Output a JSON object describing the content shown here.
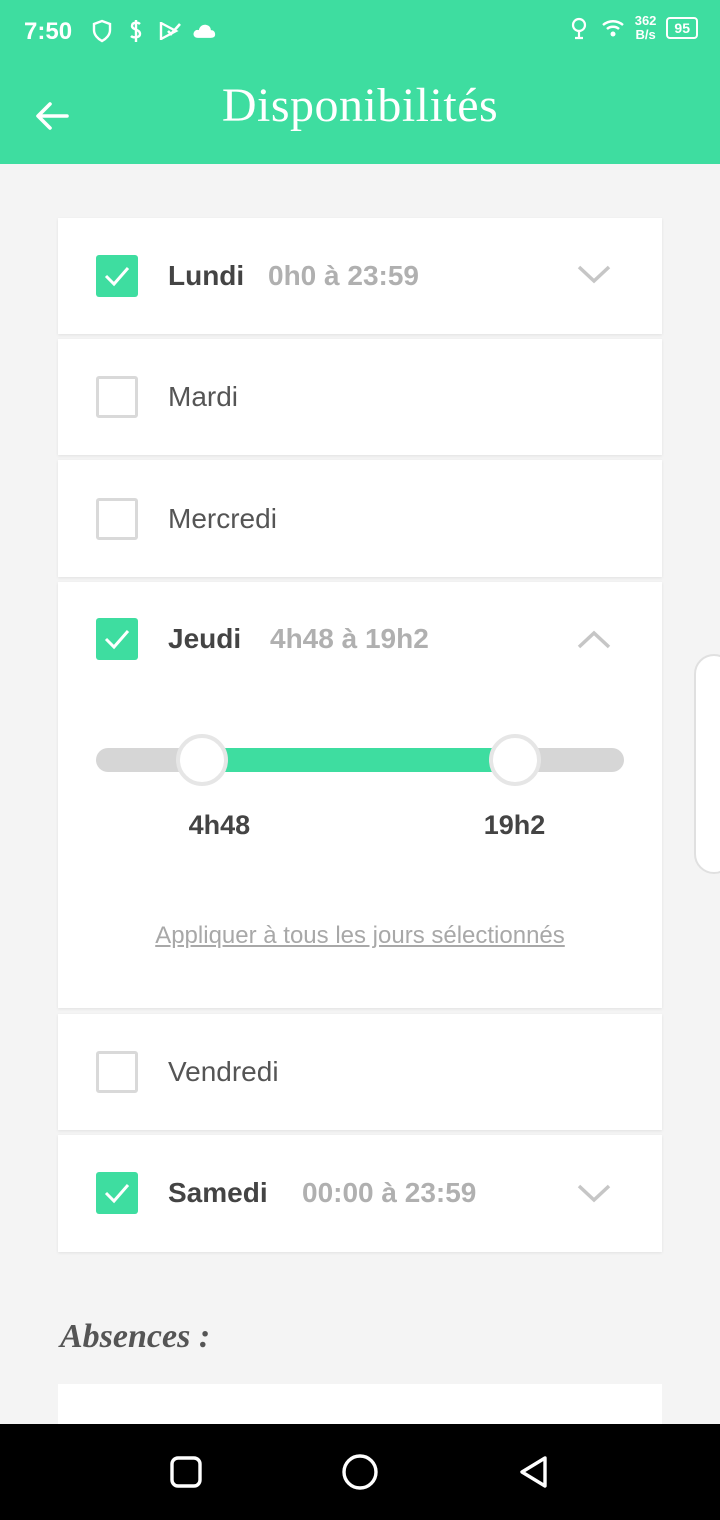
{
  "status_bar": {
    "time": "7:50",
    "net_speed_value": "362",
    "net_speed_unit": "B/s",
    "battery": "95"
  },
  "header": {
    "title": "Disponibilités"
  },
  "days": [
    {
      "name": "Lundi",
      "checked": true,
      "range": "0h0 à 23:59",
      "expanded": false
    },
    {
      "name": "Mardi",
      "checked": false,
      "range": "",
      "expanded": false
    },
    {
      "name": "Mercredi",
      "checked": false,
      "range": "",
      "expanded": false
    },
    {
      "name": "Jeudi",
      "checked": true,
      "range": "4h48 à 19h2",
      "expanded": true,
      "slider": {
        "start_label": "4h48",
        "end_label": "19h2",
        "start_fraction": 0.2,
        "end_fraction": 0.793
      },
      "apply_label": "Appliquer à tous les jours sélectionnés"
    },
    {
      "name": "Vendredi",
      "checked": false,
      "range": "",
      "expanded": false
    },
    {
      "name": "Samedi",
      "checked": true,
      "range": "00:00 à 23:59",
      "expanded": false
    }
  ],
  "absences": {
    "title": "Absences :"
  },
  "colors": {
    "accent": "#3edda0",
    "muted": "#b0b0b0"
  }
}
